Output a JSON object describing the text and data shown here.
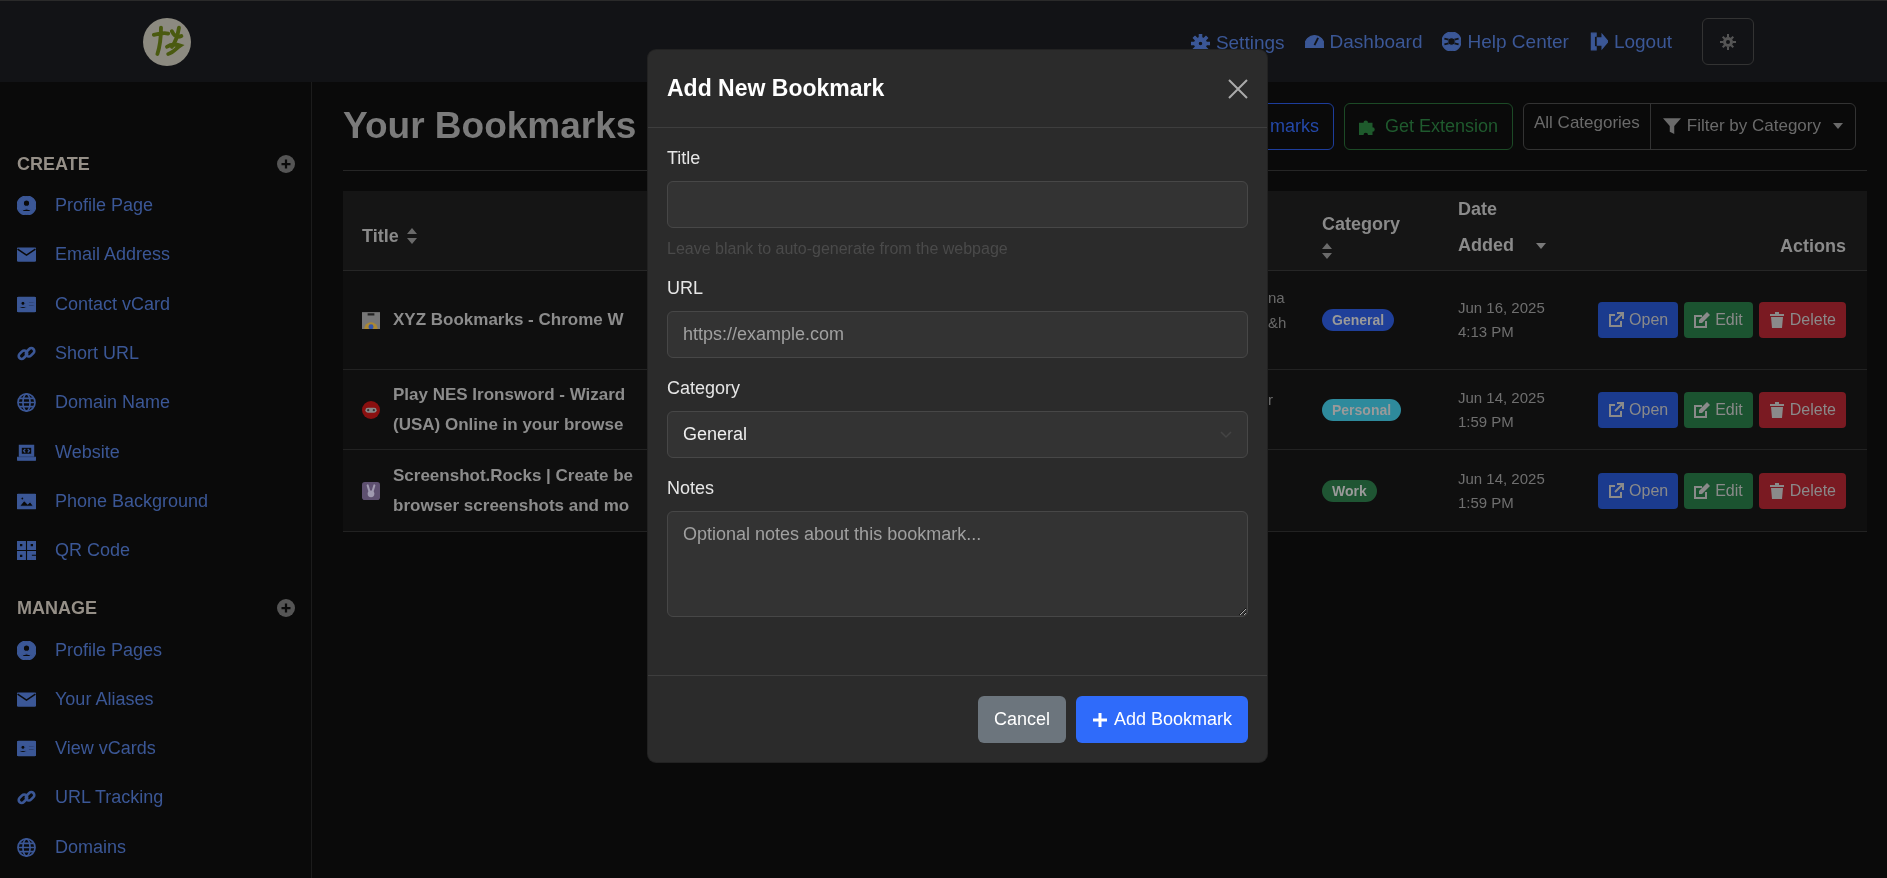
{
  "nav": [
    {
      "label": "Settings"
    },
    {
      "label": "Dashboard"
    },
    {
      "label": "Help Center"
    },
    {
      "label": "Logout"
    }
  ],
  "sidebar": [
    {
      "title": "CREATE",
      "items": [
        {
          "label": "Profile Page"
        },
        {
          "label": "Email Address"
        },
        {
          "label": "Contact vCard"
        },
        {
          "label": "Short URL"
        },
        {
          "label": "Domain Name"
        },
        {
          "label": "Website"
        },
        {
          "label": "Phone Background"
        },
        {
          "label": "QR Code"
        }
      ]
    },
    {
      "title": "MANAGE",
      "items": [
        {
          "label": "Profile Pages"
        },
        {
          "label": "Your Aliases"
        },
        {
          "label": "View vCards"
        },
        {
          "label": "URL Tracking"
        },
        {
          "label": "Domains"
        }
      ]
    }
  ],
  "heading": "Your Bookmarks",
  "toolbar": {
    "buttons": [
      {
        "kind": "primary",
        "label": "marks"
      },
      {
        "kind": "success",
        "label": "Get Extension"
      }
    ],
    "filter": {
      "value": "All Categories",
      "label": "Filter by Category"
    }
  },
  "table": {
    "columns": [
      {
        "label": "Title",
        "sortable": true,
        "sorted_descending": false
      },
      {
        "label": "Category",
        "sortable": true,
        "sorted_descending": false
      },
      {
        "label": "Date Added",
        "sortable": true,
        "sorted_descending": true
      },
      {
        "label": "Actions",
        "sortable": false,
        "sorted_descending": false
      }
    ],
    "rows": [
      {
        "title": [
          "XYZ Bookmarks - Chrome W"
        ],
        "column_3": [
          "na",
          "&h"
        ],
        "category": {
          "label": "General",
          "color": "#1f3f99"
        },
        "date": "Jun 16, 2025",
        "time": "4:13 PM",
        "actions": [
          {
            "kind": "open",
            "label": "Open"
          },
          {
            "kind": "edit",
            "label": "Edit"
          },
          {
            "kind": "delete",
            "label": "Delete"
          }
        ]
      },
      {
        "title": [
          "Play NES Ironsword - Wizard",
          "(USA) Online in your browse"
        ],
        "column_3": [
          "r"
        ],
        "category": {
          "label": "Personal",
          "color": "#2e8a9c"
        },
        "date": "Jun 14, 2025",
        "time": "1:59 PM",
        "actions": [
          {
            "kind": "open",
            "label": "Open"
          },
          {
            "kind": "edit",
            "label": "Edit"
          },
          {
            "kind": "delete",
            "label": "Delete"
          }
        ]
      },
      {
        "title": [
          "Screenshot.Rocks | Create be",
          "browser screenshots and mo"
        ],
        "column_3": [],
        "category": {
          "label": "Work",
          "color": "#1f5533"
        },
        "date": "Jun 14, 2025",
        "time": "1:59 PM",
        "actions": [
          {
            "kind": "open",
            "label": "Open"
          },
          {
            "kind": "edit",
            "label": "Edit"
          },
          {
            "kind": "delete",
            "label": "Delete"
          }
        ]
      }
    ]
  },
  "modal": {
    "title": "Add New Bookmark",
    "fields": [
      {
        "kind": "text",
        "label": "Title",
        "hint": "Leave blank to auto-generate from the webpage"
      },
      {
        "kind": "text",
        "label": "URL",
        "placeholder": "https://example.com"
      },
      {
        "kind": "select",
        "label": "Category",
        "value": "General"
      },
      {
        "kind": "textarea",
        "label": "Notes",
        "placeholder": "Optional notes about this bookmark..."
      }
    ],
    "buttons": [
      {
        "kind": "secondary",
        "label": "Cancel"
      },
      {
        "kind": "primary",
        "label": "Add Bookmark"
      }
    ]
  }
}
